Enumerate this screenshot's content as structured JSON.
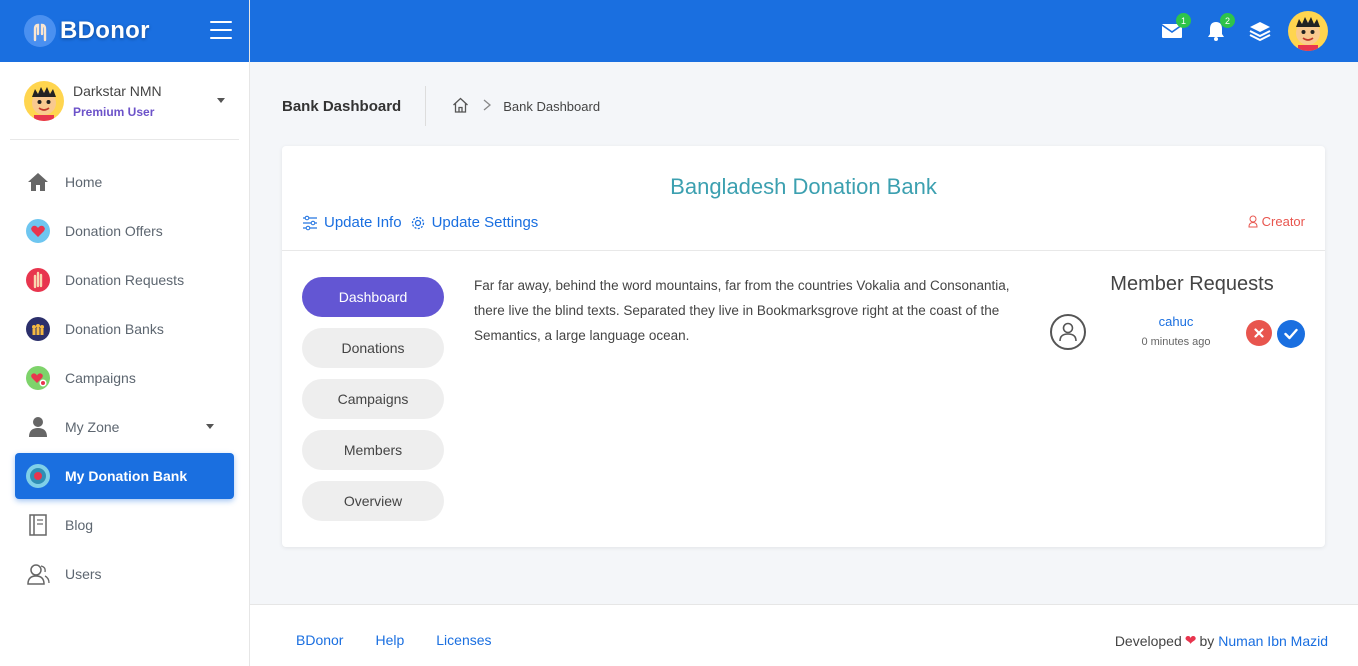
{
  "app": {
    "name": "BDonor"
  },
  "user": {
    "name": "Darkstar NMN",
    "role": "Premium User"
  },
  "nav": [
    {
      "label": "Home",
      "icon": "home-icon"
    },
    {
      "label": "Donation Offers",
      "icon": "heart-hand-icon"
    },
    {
      "label": "Donation Requests",
      "icon": "raised-hand-icon"
    },
    {
      "label": "Donation Banks",
      "icon": "bank-people-icon"
    },
    {
      "label": "Campaigns",
      "icon": "campaign-icon"
    },
    {
      "label": "My Zone",
      "icon": "person-icon"
    },
    {
      "label": "My Donation Bank",
      "icon": "target-icon"
    },
    {
      "label": "Blog",
      "icon": "notebook-icon"
    },
    {
      "label": "Users",
      "icon": "users-icon"
    }
  ],
  "topbar": {
    "messages_count": "1",
    "notifications_count": "2"
  },
  "page": {
    "title": "Bank Dashboard",
    "breadcrumb_current": "Bank Dashboard"
  },
  "bank": {
    "title": "Bangladesh Donation Bank",
    "update_info": "Update Info",
    "update_settings": "Update Settings",
    "creator": "Creator",
    "tabs": [
      "Dashboard",
      "Donations",
      "Campaigns",
      "Members",
      "Overview"
    ],
    "description": "Far far away, behind the word mountains, far from the countries Vokalia and Consonantia, there live the blind texts. Separated they live in Bookmarksgrove right at the coast of the Semantics, a large language ocean."
  },
  "member_requests": {
    "title": "Member Requests",
    "items": [
      {
        "name": "cahuc",
        "time": "0 minutes ago"
      }
    ]
  },
  "footer": {
    "links": [
      "BDonor",
      "Help",
      "Licenses"
    ],
    "developed": "Developed",
    "by": "by",
    "author": "Numan Ibn Mazid"
  },
  "colors": {
    "primary": "#1a6fe0",
    "active_tab": "#6356d3",
    "accent_title": "#3ca0b0",
    "danger": "#e8554e",
    "badge": "#2ec44a"
  }
}
